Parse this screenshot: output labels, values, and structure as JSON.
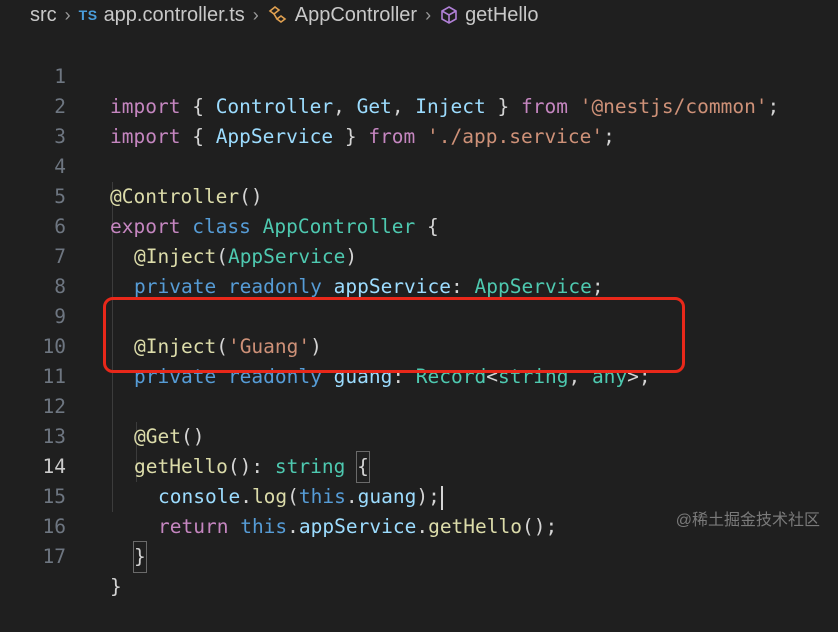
{
  "breadcrumb": {
    "root": "src",
    "ts_badge": "TS",
    "file": "app.controller.ts",
    "class": "AppController",
    "method": "getHello"
  },
  "lines": [
    {
      "n": "1"
    },
    {
      "n": "2"
    },
    {
      "n": "3"
    },
    {
      "n": "4"
    },
    {
      "n": "5"
    },
    {
      "n": "6"
    },
    {
      "n": "7"
    },
    {
      "n": "8"
    },
    {
      "n": "9"
    },
    {
      "n": "10"
    },
    {
      "n": "11"
    },
    {
      "n": "12"
    },
    {
      "n": "13"
    },
    {
      "n": "14"
    },
    {
      "n": "15"
    },
    {
      "n": "16"
    },
    {
      "n": "17"
    }
  ],
  "code": {
    "l1": {
      "import": "import",
      "open": " { ",
      "a": "Controller",
      "c1": ", ",
      "b": "Get",
      "c2": ", ",
      "c": "Inject",
      "close": " } ",
      "from": "from",
      "sp": " ",
      "str": "'@nestjs/common'",
      "semi": ";"
    },
    "l2": {
      "import": "import",
      "open": " { ",
      "a": "AppService",
      "close": " } ",
      "from": "from",
      "sp": " ",
      "str": "'./app.service'",
      "semi": ";"
    },
    "l4": {
      "at": "@",
      "dec": "Controller",
      "rest": "()"
    },
    "l5": {
      "export": "export",
      "sp1": " ",
      "class": "class",
      "sp2": " ",
      "name": "AppController",
      "brace": " {"
    },
    "l6": {
      "at": "@",
      "dec": "Inject",
      "open": "(",
      "arg": "AppService",
      "close": ")"
    },
    "l7": {
      "private": "private",
      "sp1": " ",
      "readonly": "readonly",
      "sp2": " ",
      "prop": "appService",
      "colon": ": ",
      "type": "AppService",
      "semi": ";"
    },
    "l9": {
      "at": "@",
      "dec": "Inject",
      "open": "(",
      "str": "'Guang'",
      "close": ")"
    },
    "l10": {
      "private": "private",
      "sp1": " ",
      "readonly": "readonly",
      "sp2": " ",
      "prop": "guang",
      "colon": ": ",
      "type": "Record",
      "lt": "<",
      "t1": "string",
      "comma": ", ",
      "t2": "any",
      "gt": ">",
      "semi": ";"
    },
    "l12": {
      "at": "@",
      "dec": "Get",
      "rest": "()"
    },
    "l13": {
      "fn": "getHello",
      "parens": "()",
      "colon": ": ",
      "type": "string",
      "sp": " ",
      "brace": "{"
    },
    "l14": {
      "obj": "console",
      "dot": ".",
      "fn": "log",
      "open": "(",
      "this": "this",
      "dot2": ".",
      "prop": "guang",
      "close": ");"
    },
    "l15": {
      "ret": "return",
      "sp": " ",
      "this": "this",
      "dot": ".",
      "prop": "appService",
      "dot2": ".",
      "fn": "getHello",
      "rest": "();"
    },
    "l16": {
      "brace": "}"
    },
    "l17": {
      "brace": "}"
    }
  },
  "watermark": "@稀土掘金技术社区",
  "colors": {
    "background": "#1f1f1f",
    "keyword": "#c586c0",
    "storage": "#569cd6",
    "type": "#4ec9b0",
    "variable": "#9cdcfe",
    "string": "#ce9178",
    "function": "#dcdcaa",
    "highlight_box": "#e8281a"
  }
}
